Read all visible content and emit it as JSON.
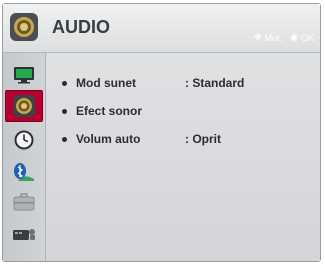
{
  "header": {
    "title": "AUDIO",
    "hints": [
      {
        "label": "Mut.",
        "icon": "dpad-icon"
      },
      {
        "label": "OK",
        "icon": "ok-dot-icon"
      }
    ]
  },
  "sidebar": {
    "items": [
      {
        "name": "picture",
        "icon": "tv-monitor-icon",
        "active": false
      },
      {
        "name": "audio",
        "icon": "speaker-icon",
        "active": true
      },
      {
        "name": "time",
        "icon": "clock-icon",
        "active": false
      },
      {
        "name": "network",
        "icon": "bluetooth-icon",
        "active": false
      },
      {
        "name": "options",
        "icon": "briefcase-icon",
        "active": false
      },
      {
        "name": "input",
        "icon": "input-device-icon",
        "active": false
      }
    ]
  },
  "menu": {
    "items": [
      {
        "label": "Mod sunet",
        "value": ": Standard"
      },
      {
        "label": "Efect sonor",
        "value": ""
      },
      {
        "label": "Volum auto",
        "value": ": Oprit"
      }
    ]
  },
  "colors": {
    "accent": "#b8002f",
    "panel": "#d7d9dc",
    "text": "#2a2c2e"
  }
}
